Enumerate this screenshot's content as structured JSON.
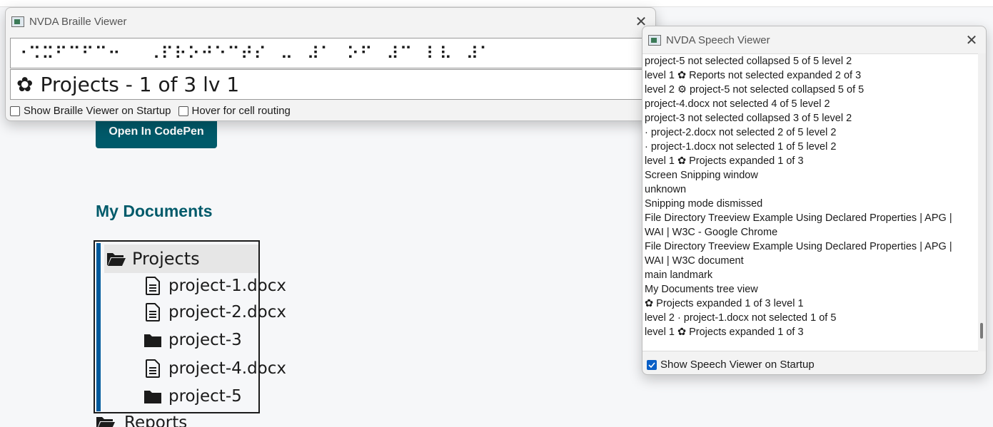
{
  "page": {
    "codepen_button": "Open In CodePen",
    "heading": "My Documents",
    "tree": {
      "root_label": "Projects",
      "children": [
        {
          "label": "project-1.docx",
          "icon": "document-icon"
        },
        {
          "label": "project-2.docx",
          "icon": "document-icon"
        },
        {
          "label": "project-3",
          "icon": "folder-icon"
        },
        {
          "label": "project-4.docx",
          "icon": "document-icon"
        },
        {
          "label": "project-5",
          "icon": "folder-icon"
        }
      ],
      "next_root_label": "Reports"
    }
  },
  "braille_viewer": {
    "title": "NVDA Braille Viewer",
    "cells": "⠐⠩⠭⠋⠉⠋⠉⠒⠀⠀⠠⠏⠗⠕⠚⠑⠉⠞⠎⠀⠤⠀⠼⠁⠀⠕⠋⠀⠼⠉⠀⠇⠧⠀⠼⠁",
    "text_marker": "✿",
    "text": "Projects - 1 of 3 lv 1",
    "option_startup": "Show Braille Viewer on Startup",
    "option_hover": "Hover for cell routing"
  },
  "speech_viewer": {
    "title": "NVDA Speech Viewer",
    "lines": [
      "project-5  not selected  collapsed  5 of 5  level 2",
      "level 1  ✿ Reports  not selected  expanded  2 of 3",
      "level 2  ⚙ project-5  not selected  collapsed  5 of 5",
      "project-4.docx  not selected  4 of 5  level 2",
      "project-3  not selected  collapsed  3 of 5  level 2",
      "·  project-2.docx  not selected  2 of 5  level 2",
      "·  project-1.docx  not selected  1 of 5  level 2",
      "level 1  ✿ Projects  expanded  1 of 3",
      "Screen Snipping  window",
      "unknown",
      "Snipping mode dismissed",
      "File Directory Treeview Example Using Declared Properties | APG |",
      "WAI | W3C - Google Chrome",
      "File Directory Treeview Example Using Declared Properties | APG |",
      "WAI | W3C  document",
      "main landmark",
      "My Documents  tree view",
      "✿ Projects  expanded  1 of 3  level 1",
      "level 2  ·  project-1.docx  not selected  1 of 5",
      "level 1  ✿ Projects  expanded  1 of 3"
    ],
    "option_startup": "Show Speech Viewer on Startup"
  }
}
